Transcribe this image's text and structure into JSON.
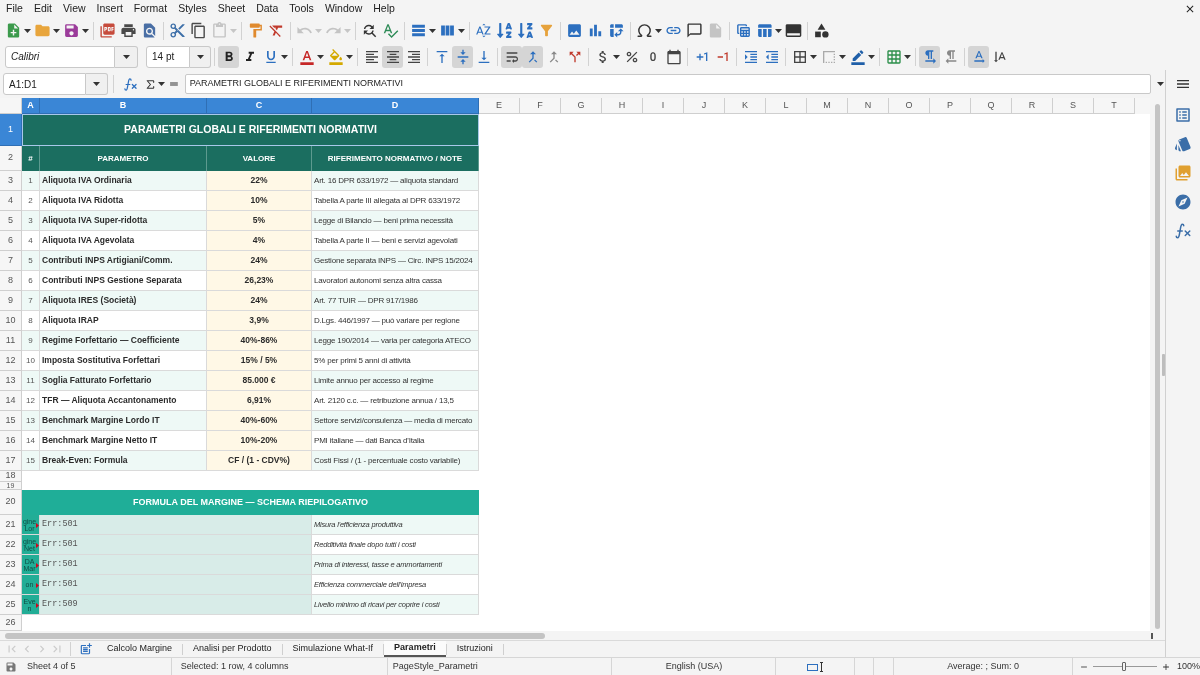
{
  "menu": [
    "File",
    "Edit",
    "View",
    "Insert",
    "Format",
    "Styles",
    "Sheet",
    "Data",
    "Tools",
    "Window",
    "Help"
  ],
  "standard_toolbar": [
    {
      "disabled": false
    },
    {
      "disabled": false
    },
    {
      "disabled": false
    },
    {
      "disabled": false
    },
    {
      "disabled": false
    },
    {
      "disabled": false
    },
    {
      "disabled": false
    },
    {
      "disabled": false
    },
    {
      "disabled": true
    },
    {
      "disabled": false
    },
    {
      "disabled": false
    },
    {
      "disabled": true
    },
    {
      "disabled": true
    },
    {
      "disabled": false
    },
    {
      "disabled": false
    },
    {
      "disabled": false
    },
    {
      "disabled": false
    },
    {
      "disabled": false
    },
    {
      "disabled": false
    },
    {
      "disabled": false
    },
    {
      "disabled": false
    },
    {
      "disabled": false
    },
    {
      "disabled": false
    },
    {
      "disabled": false
    },
    {
      "disabled": false
    },
    {
      "disabled": false
    },
    {
      "disabled": false
    },
    {
      "disabled": true
    },
    {
      "disabled": false
    },
    {
      "disabled": false
    },
    {
      "disabled": false
    },
    {
      "disabled": false
    }
  ],
  "formatting_toolbar": {
    "font_name": "Calibri",
    "font_size": "14 pt",
    "buttons": [
      {
        "pressed": true
      },
      {
        "pressed": false
      },
      {
        "pressed": false
      },
      {
        "pressed": false
      },
      {
        "pressed": false
      },
      {
        "pressed": false
      },
      {
        "pressed": true
      },
      {
        "pressed": false
      },
      {
        "pressed": false
      },
      {
        "pressed": true
      },
      {
        "pressed": false
      },
      {
        "pressed": true
      },
      {
        "pressed": true
      },
      {
        "pressed": false
      },
      {
        "pressed": false
      },
      {
        "pressed": false
      },
      {
        "pressed": false
      },
      {
        "pressed": false
      },
      {
        "pressed": false
      },
      {
        "pressed": false
      },
      {
        "pressed": false
      },
      {
        "pressed": false
      },
      {
        "pressed": false
      },
      {
        "pressed": false
      },
      {
        "pressed": false
      },
      {
        "pressed": false
      },
      {
        "pressed": false
      },
      {
        "pressed": true
      },
      {
        "pressed": false
      },
      {
        "pressed": true
      },
      {
        "pressed": false
      }
    ]
  },
  "formula_bar": {
    "name_box": "A1:D1",
    "content": "PARAMETRI GLOBALI E RIFERIMENTI NORMATIVI"
  },
  "sheet": {
    "column_headers": [
      {
        "label": "A",
        "selected": true
      },
      {
        "label": "B",
        "selected": true
      },
      {
        "label": "C",
        "selected": true
      },
      {
        "label": "D",
        "selected": true
      },
      {
        "label": "E",
        "selected": false
      },
      {
        "label": "F",
        "selected": false
      },
      {
        "label": "G",
        "selected": false
      },
      {
        "label": "H",
        "selected": false
      },
      {
        "label": "I",
        "selected": false
      },
      {
        "label": "J",
        "selected": false
      },
      {
        "label": "K",
        "selected": false
      },
      {
        "label": "L",
        "selected": false
      },
      {
        "label": "M",
        "selected": false
      },
      {
        "label": "N",
        "selected": false
      },
      {
        "label": "O",
        "selected": false
      },
      {
        "label": "P",
        "selected": false
      },
      {
        "label": "Q",
        "selected": false
      },
      {
        "label": "R",
        "selected": false
      },
      {
        "label": "S",
        "selected": false
      },
      {
        "label": "T",
        "selected": false
      }
    ],
    "row_headers": [
      {
        "label": "1",
        "selected": true
      },
      {
        "label": "2",
        "selected": false
      },
      {
        "label": "3",
        "selected": false
      },
      {
        "label": "4",
        "selected": false
      },
      {
        "label": "5",
        "selected": false
      },
      {
        "label": "6",
        "selected": false
      },
      {
        "label": "7",
        "selected": false
      },
      {
        "label": "8",
        "selected": false
      },
      {
        "label": "9",
        "selected": false
      },
      {
        "label": "10",
        "selected": false
      },
      {
        "label": "11",
        "selected": false
      },
      {
        "label": "12",
        "selected": false
      },
      {
        "label": "13",
        "selected": false
      },
      {
        "label": "14",
        "selected": false
      },
      {
        "label": "15",
        "selected": false
      },
      {
        "label": "16",
        "selected": false
      },
      {
        "label": "17",
        "selected": false
      },
      {
        "label": "18",
        "selected": false
      },
      {
        "label": "19",
        "selected": false
      },
      {
        "label": "20",
        "selected": false
      },
      {
        "label": "21",
        "selected": false
      },
      {
        "label": "22",
        "selected": false
      },
      {
        "label": "23",
        "selected": false
      },
      {
        "label": "24",
        "selected": false
      },
      {
        "label": "25",
        "selected": false
      },
      {
        "label": "26",
        "selected": false
      }
    ],
    "title": "PARAMETRI GLOBALI E RIFERIMENTI NORMATIVI",
    "parameters_table": {
      "columns": [
        "#",
        "PARAMETRO",
        "VALORE",
        "RIFERIMENTO NORMATIVO / NOTE"
      ],
      "rows": [
        {
          "number": "1",
          "parametro": "Aliquota IVA Ordinaria",
          "valore": "22%",
          "note": "Art. 16 DPR 633/1972 — aliquota standard"
        },
        {
          "number": "2",
          "parametro": "Aliquota IVA Ridotta",
          "valore": "10%",
          "note": "Tabella A parte III allegata al DPR 633/1972"
        },
        {
          "number": "3",
          "parametro": "Aliquota IVA Super-ridotta",
          "valore": "5%",
          "note": "Legge di Bilancio — beni prima necessità"
        },
        {
          "number": "4",
          "parametro": "Aliquota IVA Agevolata",
          "valore": "4%",
          "note": "Tabella A parte II — beni e servizi agevolati"
        },
        {
          "number": "5",
          "parametro": "Contributi INPS Artigiani/Comm.",
          "valore": "24%",
          "note": "Gestione separata INPS — Circ. INPS 15/2024"
        },
        {
          "number": "6",
          "parametro": "Contributi INPS Gestione Separata",
          "valore": "26,23%",
          "note": "Lavoratori autonomi senza altra cassa"
        },
        {
          "number": "7",
          "parametro": "Aliquota IRES (Società)",
          "valore": "24%",
          "note": "Art. 77 TUIR — DPR 917/1986"
        },
        {
          "number": "8",
          "parametro": "Aliquota IRAP",
          "valore": "3,9%",
          "note": "D.Lgs. 446/1997 — può variare per regione"
        },
        {
          "number": "9",
          "parametro": "Regime Forfettario — Coefficiente",
          "valore": "40%-86%",
          "note": "Legge 190/2014 — varia per categoria ATECO"
        },
        {
          "number": "10",
          "parametro": "Imposta Sostitutiva Forfettari",
          "valore": "15% / 5%",
          "note": "5% per primi 5 anni di attività"
        },
        {
          "number": "11",
          "parametro": "Soglia Fatturato Forfettario",
          "valore": "85.000 €",
          "note": "Limite annuo per accesso al regime"
        },
        {
          "number": "12",
          "parametro": "TFR — Aliquota Accantonamento",
          "valore": "6,91%",
          "note": "Art. 2120 c.c. — retribuzione annua / 13,5"
        },
        {
          "number": "13",
          "parametro": "Benchmark Margine Lordo IT",
          "valore": "40%-60%",
          "note": "Settore servizi/consulenza — media di mercato"
        },
        {
          "number": "14",
          "parametro": "Benchmark Margine Netto IT",
          "valore": "10%-20%",
          "note": "PMI italiane — dati Banca d'Italia"
        },
        {
          "number": "15",
          "parametro": "Break-Even: Formula",
          "valore": "CF / (1 - CDV%)",
          "note": "Costi Fissi / (1 - percentuale costo variabile)"
        }
      ]
    },
    "section_title": "FORMULA DEL MARGINE — SCHEMA RIEPILOGATIVO",
    "formula_rows": [
      {
        "column_a": "gine Lor",
        "result": "Err:501",
        "note": "Misura l'efficienza produttiva"
      },
      {
        "column_a": "gine Net",
        "result": "Err:501",
        "note": "Redditività finale dopo tutti i costi"
      },
      {
        "column_a": "DA Mar",
        "result": "Err:501",
        "note": "Prima di interessi, tasse e ammortamenti"
      },
      {
        "column_a": "on",
        "result": "Err:501",
        "note": "Efficienza commerciale dell'impresa"
      },
      {
        "column_a": "Even",
        "result": "Err:509",
        "note": "Livello minimo di ricavi per coprire i costi"
      }
    ]
  },
  "sheet_navigation": [
    {
      "disabled": true
    },
    {
      "disabled": true
    },
    {
      "disabled": true
    },
    {
      "disabled": true
    }
  ],
  "sheet_tabs": [
    {
      "label": "Calcolo Margine",
      "selected": false
    },
    {
      "label": "Analisi per Prodotto",
      "selected": false
    },
    {
      "label": "Simulazione What-If",
      "selected": false
    },
    {
      "label": "Parametri",
      "selected": true
    },
    {
      "label": "Istruzioni",
      "selected": false
    }
  ],
  "status_bar": {
    "sheet": "Sheet 4 of 5",
    "selection": "Selected: 1 row, 4 columns",
    "page_style": "PageStyle_Parametri",
    "language": "English (USA)",
    "summary": "Average: ; Sum: 0",
    "zoom": {
      "level": 0.48,
      "reading": "100%"
    }
  }
}
